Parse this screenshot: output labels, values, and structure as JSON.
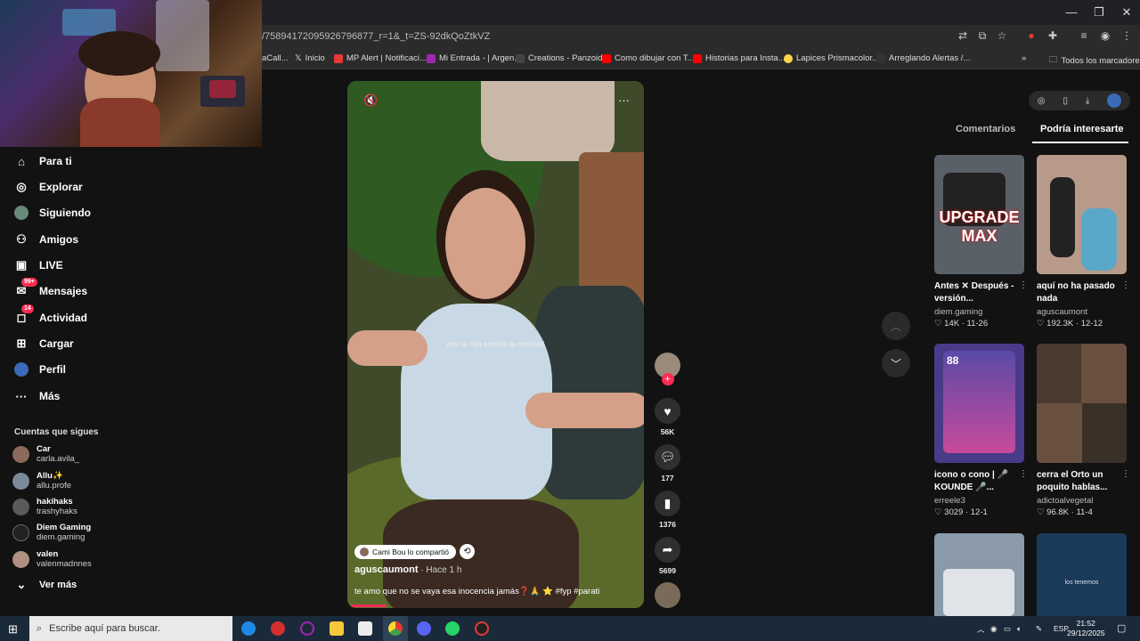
{
  "browser": {
    "url": "/75894172095926796877_r=1&_t=ZS-92dkQoZtkVZ",
    "bookmarks": [
      {
        "label": "aCall...",
        "color": "#555555"
      },
      {
        "label": "Inicio",
        "color": "#000000"
      },
      {
        "label": "MP Alert | Notificaci...",
        "color": "#e53935"
      },
      {
        "label": "Mi Entrada - | Argen...",
        "color": "#9c27b0"
      },
      {
        "label": "Creations - Panzoid",
        "color": "#444444"
      },
      {
        "label": "Como dibujar con T...",
        "color": "#ff0000"
      },
      {
        "label": "Historias para Insta...",
        "color": "#ff0000"
      },
      {
        "label": "Lapices Prismacolor...",
        "color": "#ffd54f"
      },
      {
        "label": "Arreglando Alertas /...",
        "color": "#333333"
      }
    ],
    "all_bookmarks": "Todos los marcadores",
    "overflow": "»"
  },
  "sidebar": {
    "items": [
      {
        "label": "Para ti",
        "icon": "home-icon",
        "glyph": "⌂"
      },
      {
        "label": "Explorar",
        "icon": "compass-icon",
        "glyph": "◎"
      },
      {
        "label": "Siguiendo",
        "icon": "following-avatar-icon",
        "glyph": "●"
      },
      {
        "label": "Amigos",
        "icon": "friends-icon",
        "glyph": "👥"
      },
      {
        "label": "LIVE",
        "icon": "live-tv-icon",
        "glyph": "▣"
      },
      {
        "label": "Mensajes",
        "icon": "messages-icon",
        "glyph": "✉",
        "badge": "99+"
      },
      {
        "label": "Actividad",
        "icon": "activity-icon",
        "glyph": "◻",
        "badge": "14"
      },
      {
        "label": "Cargar",
        "icon": "upload-icon",
        "glyph": "⊞"
      },
      {
        "label": "Perfil",
        "icon": "profile-avatar-icon",
        "glyph": "●"
      },
      {
        "label": "Más",
        "icon": "more-icon",
        "glyph": "···"
      }
    ],
    "following_header": "Cuentas que sigues",
    "following": [
      {
        "name": "Car",
        "handle": "carla.avila_",
        "color": "#8a6a5a"
      },
      {
        "name": "Allu✨",
        "handle": "allu.profe",
        "color": "#7a8a9a"
      },
      {
        "name": "hakihaks",
        "handle": "trashyhaks",
        "color": "#6a6a6a"
      },
      {
        "name": "Diem Gaming",
        "handle": "diem.gaming",
        "color": "#222222"
      },
      {
        "name": "valen",
        "handle": "valenmadnnes",
        "color": "#b09080"
      }
    ],
    "see_more": "Ver más"
  },
  "video": {
    "overlay_text": "pov tu hija analiza la navidad",
    "shared_by": "Cami Bou lo compartió",
    "author": "aguscaumont",
    "time": " · Hace 1 h",
    "description": "te amo que no se vaya esa inocencia jamás❓🙏 ⭐ #fyp #parati"
  },
  "actions": {
    "likes": "56K",
    "comments": "177",
    "saves": "1376",
    "shares": "5699"
  },
  "right_panel": {
    "tabs": [
      "Comentarios",
      "Podría interesarte"
    ],
    "cards": [
      {
        "title": "Antes ✕ Después - versión...",
        "author": "diem.gaming",
        "likes": "14K",
        "date": "11-26",
        "thumb_text": "UPGRADE MAX",
        "bg": "#5a6068"
      },
      {
        "title": "aquí no ha pasado nada",
        "author": "aguscaumont",
        "likes": "192.3K",
        "date": "12-12",
        "thumb_text": "",
        "bg": "#b89a8a"
      },
      {
        "title": "icono o cono | 🎤 KOUNDE 🎤...",
        "author": "erreele3",
        "likes": "3029",
        "date": "12-1",
        "thumb_text": "88",
        "bg": "#4a3a8a"
      },
      {
        "title": "cerra el Orto un poquito hablas...",
        "author": "adictoalvegetal",
        "likes": "96.8K",
        "date": "11-4",
        "thumb_text": "",
        "bg": "#6a5040"
      },
      {
        "title": "",
        "author": "",
        "likes": "",
        "date": "",
        "thumb_text": "",
        "bg": "#8a9aa8"
      },
      {
        "title": "",
        "author": "",
        "likes": "",
        "date": "",
        "thumb_text": "los tenemos",
        "bg": "#1a3a5a"
      }
    ]
  },
  "taskbar": {
    "search_placeholder": "Escribe aquí para buscar.",
    "lang": "ESP",
    "time": "21:52",
    "date": "29/12/2025"
  }
}
